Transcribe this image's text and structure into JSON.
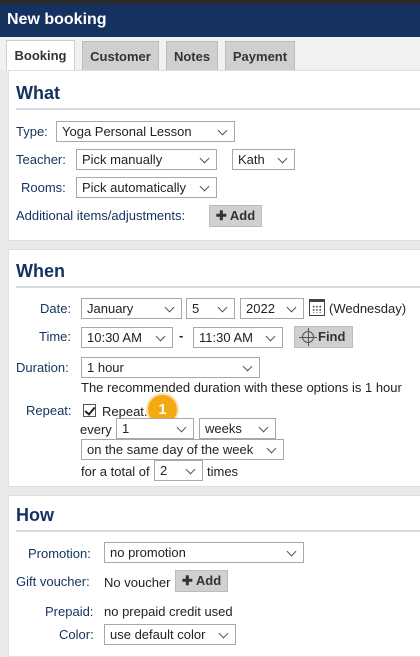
{
  "title": "New booking",
  "tabs": [
    "Booking",
    "Customer",
    "Notes",
    "Payment"
  ],
  "what": {
    "heading": "What",
    "type_label": "Type:",
    "type_value": "Yoga Personal Lesson",
    "teacher_label": "Teacher:",
    "teacher_mode": "Pick manually",
    "teacher_value": "Kath",
    "rooms_label": "Rooms:",
    "rooms_value": "Pick automatically",
    "additional_label": "Additional items/adjustments:",
    "add_label": "Add"
  },
  "when": {
    "heading": "When",
    "date_label": "Date:",
    "month": "January",
    "day": "5",
    "year": "2022",
    "weekday": "(Wednesday)",
    "time_label": "Time:",
    "start_time": "10:30 AM",
    "dash": "-",
    "end_time": "11:30 AM",
    "find_label": "Find",
    "duration_label": "Duration:",
    "duration_value": "1 hour",
    "duration_note": "The recommended duration with these options is 1 hour",
    "repeat_label": "Repeat:",
    "repeat_checkbox_label": "Repeat.",
    "repeat_checked": true,
    "every_label": "every",
    "every_value": "1",
    "every_unit": "weeks",
    "pattern": "on the same day of the week",
    "total_label": "for a total of",
    "total_value": "2",
    "times_label": "times",
    "badge": "1"
  },
  "how": {
    "heading": "How",
    "promotion_label": "Promotion:",
    "promotion_value": "no promotion",
    "gift_label": "Gift voucher:",
    "gift_value": "No voucher",
    "add_label": "Add",
    "prepaid_label": "Prepaid:",
    "prepaid_value": "no prepaid credit used",
    "color_label": "Color:",
    "color_value": "use default color"
  },
  "colors": {
    "title_bar": "#14315f",
    "label": "#14315f",
    "badge": "#f3a90f"
  }
}
